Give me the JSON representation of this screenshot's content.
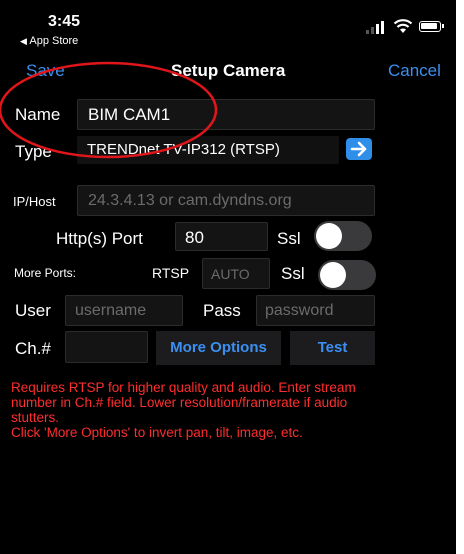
{
  "status_bar": {
    "time": "3:45",
    "back_app": "App Store",
    "back_arrow": "◀"
  },
  "nav": {
    "save_label": "Save",
    "title": "Setup Camera",
    "cancel_label": "Cancel"
  },
  "form": {
    "name_label": "Name",
    "name_value": "BIM CAM1",
    "type_label": "Type",
    "type_value": "TRENDnet TV-IP312 (RTSP)",
    "iphost_label": "IP/Host",
    "iphost_placeholder": "24.3.4.13 or cam.dyndns.org",
    "http_port_label": "Http(s) Port",
    "http_port_value": "80",
    "ssl_label": "Ssl",
    "ssl_on": false,
    "more_ports_label": "More Ports:",
    "rtsp_label": "RTSP",
    "rtsp_placeholder": "AUTO",
    "rtsp_ssl_label": "Ssl",
    "rtsp_ssl_on": false,
    "user_label": "User",
    "user_placeholder": "username",
    "pass_label": "Pass",
    "pass_placeholder": "password",
    "channel_label": "Ch.#",
    "channel_value": "",
    "more_options_label": "More Options",
    "test_label": "Test"
  },
  "help_text": [
    "Requires RTSP for higher quality and audio. Enter stream",
    "number in Ch.# field. Lower resolution/framerate if audio",
    "stutters.",
    "Click 'More Options' to invert pan, tilt, image, etc."
  ],
  "colors": {
    "background": "#000000",
    "accent": "#3b8ff0",
    "help_text": "#ff2d2d",
    "annotation_circle": "#e0161b"
  }
}
